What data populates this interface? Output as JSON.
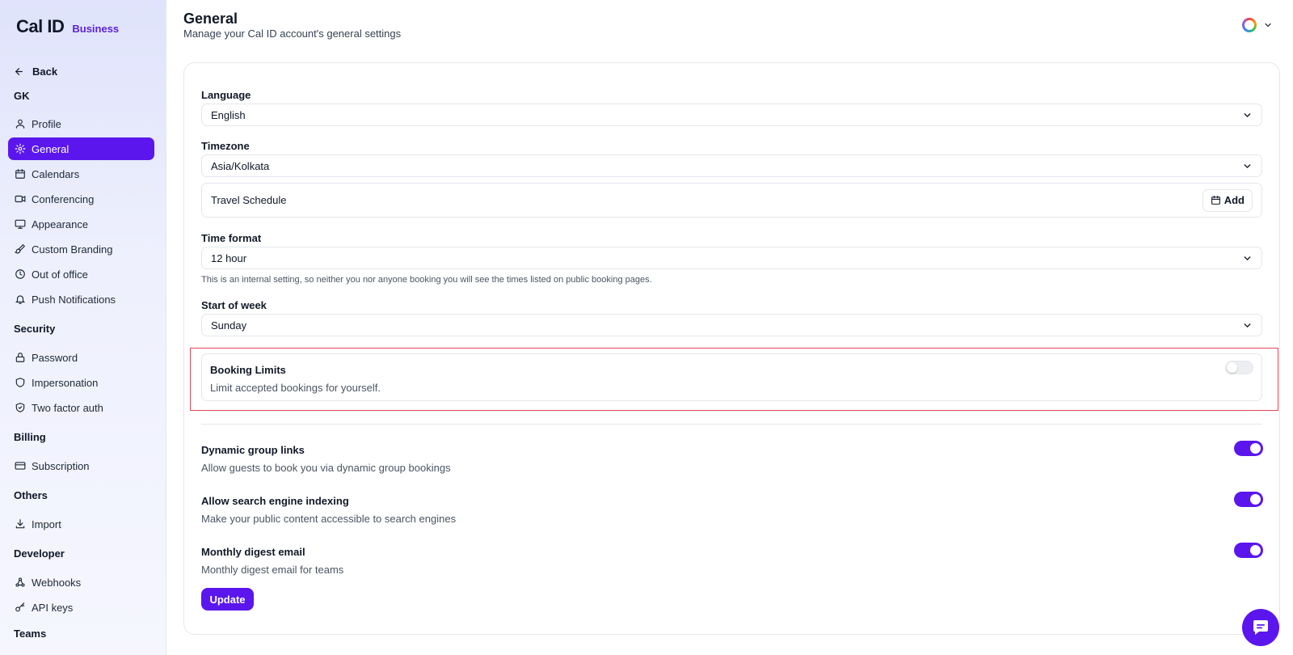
{
  "brand": {
    "logo": "Cal ID",
    "tag": "Business"
  },
  "sidebar": {
    "back_label": "Back",
    "groups": {
      "user": "GK",
      "security": "Security",
      "billing": "Billing",
      "others": "Others",
      "developer": "Developer",
      "teams": "Teams"
    },
    "items": {
      "profile": "Profile",
      "general": "General",
      "calendars": "Calendars",
      "conferencing": "Conferencing",
      "appearance": "Appearance",
      "custom_branding": "Custom Branding",
      "out_of_office": "Out of office",
      "push_notifications": "Push Notifications",
      "password": "Password",
      "impersonation": "Impersonation",
      "two_factor": "Two factor auth",
      "subscription": "Subscription",
      "import": "Import",
      "webhooks": "Webhooks",
      "api_keys": "API keys"
    },
    "active_item": "general"
  },
  "header": {
    "title": "General",
    "subtitle": "Manage your Cal ID account's general settings"
  },
  "form": {
    "language": {
      "label": "Language",
      "value": "English"
    },
    "timezone": {
      "label": "Timezone",
      "value": "Asia/Kolkata"
    },
    "travel_schedule": {
      "label": "Travel Schedule",
      "add_label": "Add"
    },
    "time_format": {
      "label": "Time format",
      "value": "12 hour",
      "hint": "This is an internal setting, so neither you nor anyone booking you will see the times listed on public booking pages."
    },
    "start_of_week": {
      "label": "Start of week",
      "value": "Sunday"
    },
    "booking_limits": {
      "title": "Booking Limits",
      "description": "Limit accepted bookings for yourself.",
      "enabled": false
    },
    "dynamic_group_links": {
      "title": "Dynamic group links",
      "description": "Allow guests to book you via dynamic group bookings",
      "enabled": true
    },
    "search_engine_indexing": {
      "title": "Allow search engine indexing",
      "description": "Make your public content accessible to search engines",
      "enabled": true
    },
    "monthly_digest": {
      "title": "Monthly digest email",
      "description": "Monthly digest email for teams",
      "enabled": true
    },
    "update_label": "Update"
  },
  "colors": {
    "accent": "#5b16ed",
    "highlight_border": "#e0475b"
  }
}
